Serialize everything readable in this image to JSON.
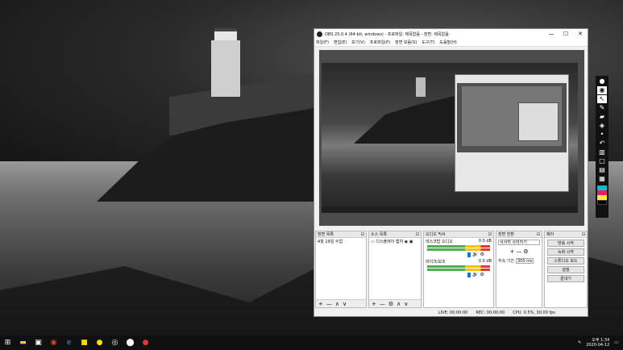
{
  "window": {
    "title": "OBS 25.0.4 (64-bit, windows) - 프로파일: 제목없음 - 장면: 제목없음",
    "controls": {
      "minimize": "—",
      "maximize": "☐",
      "close": "✕"
    }
  },
  "menu": [
    "파일(F)",
    "편집(E)",
    "보기(V)",
    "프로파일(P)",
    "장면 모음(S)",
    "도구(T)",
    "도움말(H)"
  ],
  "docks": {
    "scenes": {
      "title": "장면 목록",
      "items": [
        "4월 19일 수업"
      ]
    },
    "sources": {
      "title": "소스 목록",
      "items": [
        "디스플레이 캡처"
      ]
    },
    "mixer": {
      "title": "오디오 믹서",
      "channels": [
        {
          "name": "데스크탑 오디오",
          "db": "0.0 dB"
        },
        {
          "name": "마이크/보조",
          "db": "0.0 dB"
        }
      ]
    },
    "transitions": {
      "title": "장면 전환",
      "type": "서서히 사라지기",
      "duration_label": "지속 기간",
      "duration_value": "300 ms"
    },
    "controls": {
      "title": "제어",
      "buttons": [
        "방송 시작",
        "녹화 시작",
        "스튜디오 모드",
        "설정",
        "끝내기"
      ]
    }
  },
  "footer_symbols": {
    "add": "+",
    "remove": "—",
    "up": "∧",
    "down": "∨",
    "gear": "⚙",
    "pin": "⊡"
  },
  "statusbar": {
    "live": "LIVE: 00:00:00",
    "rec": "REC: 00:00:00",
    "cpu": "CPU: 0.5%, 30.00 fps"
  },
  "taskbar": {
    "time": "오후 1:34",
    "date": "2020-04-12",
    "icons": [
      "windows-start-icon",
      "file-explorer-icon",
      "store-icon",
      "chrome-icon",
      "edge-icon",
      "sticky-notes-icon",
      "kakaotalk-icon",
      "obs-icon",
      "maps-icon",
      "whale-icon"
    ]
  },
  "pen_toolbar": {
    "colors": [
      "#00bcd4",
      "#e91e63",
      "#ffeb3b",
      "#000000"
    ]
  }
}
